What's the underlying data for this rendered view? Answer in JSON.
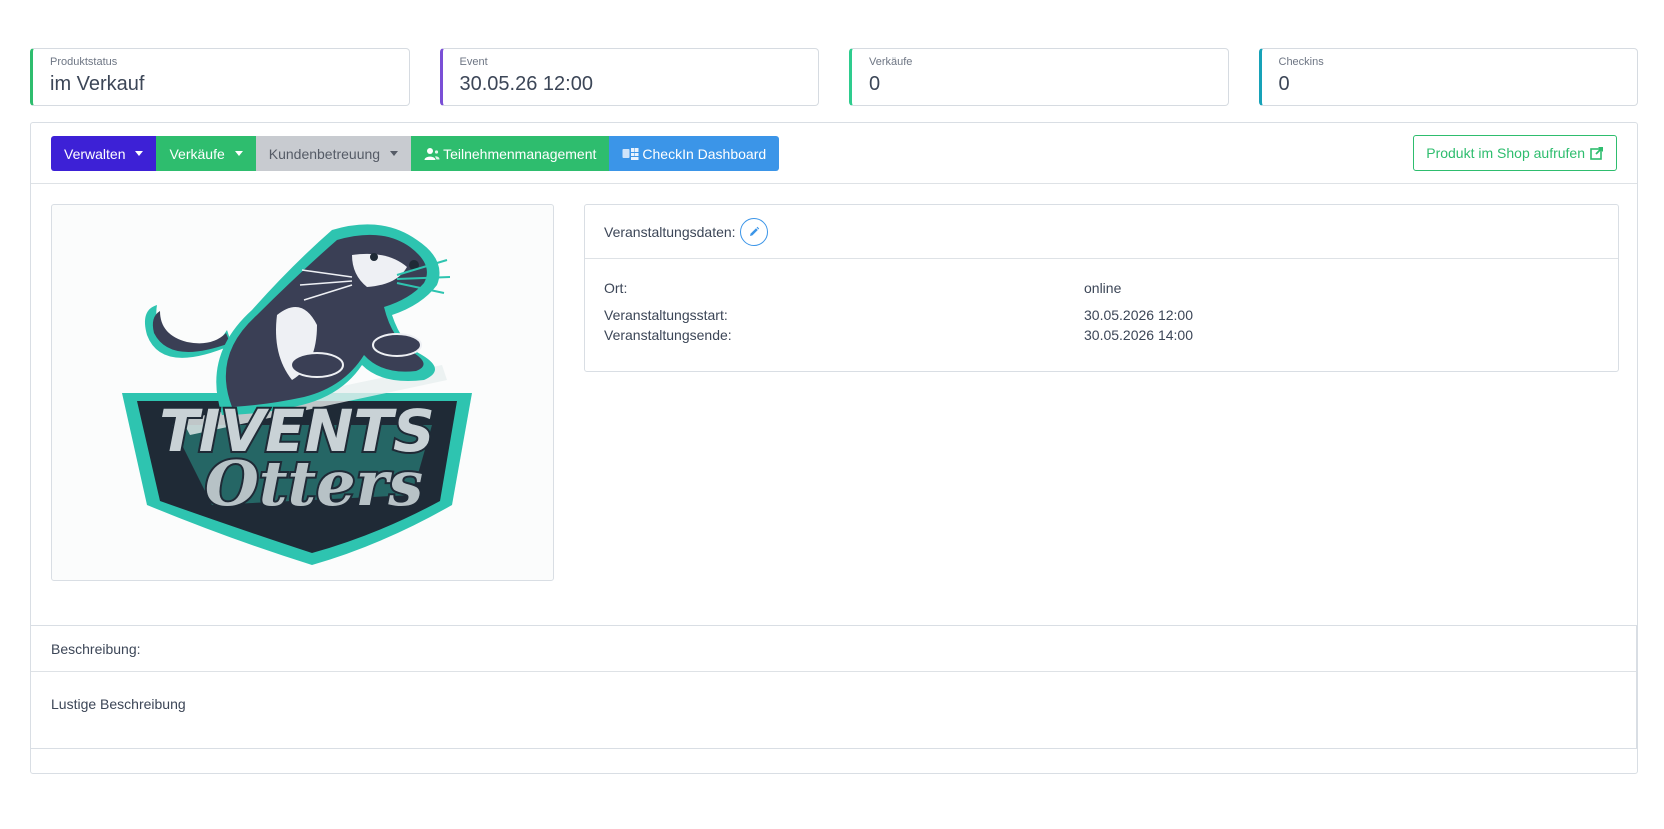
{
  "stats": [
    {
      "label": "Produktstatus",
      "value": "im Verkauf",
      "color": "#2ebd6e"
    },
    {
      "label": "Event",
      "value": "30.05.26 12:00",
      "color": "#7a4fd6"
    },
    {
      "label": "Verkäufe",
      "value": "0",
      "color": "#2ecc8e"
    },
    {
      "label": "Checkins",
      "value": "0",
      "color": "#17a2b8"
    }
  ],
  "toolbar": {
    "verwalten": "Verwalten",
    "verkaeufe": "Verkäufe",
    "kundenbetreuung": "Kundenbetreuung",
    "teilnehmer": "Teilnehmenmanagement",
    "checkin": "CheckIn Dashboard",
    "shop": "Produkt im Shop aufrufen"
  },
  "logo": {
    "line1": "TIVENTS",
    "line2": "Otters"
  },
  "event_info": {
    "heading": "Veranstaltungsdaten:",
    "ort_label": "Ort:",
    "ort_value": "online",
    "start_label": "Veranstaltungsstart:",
    "start_value": "30.05.2026 12:00",
    "end_label": "Veranstaltungsende:",
    "end_value": "30.05.2026 14:00"
  },
  "description": {
    "heading": "Beschreibung:",
    "text": "Lustige Beschreibung"
  },
  "colors": {
    "primary": "#3d21d6",
    "success": "#2ebd6e",
    "secondary": "#c8cbd0",
    "info": "#3b95e8"
  }
}
